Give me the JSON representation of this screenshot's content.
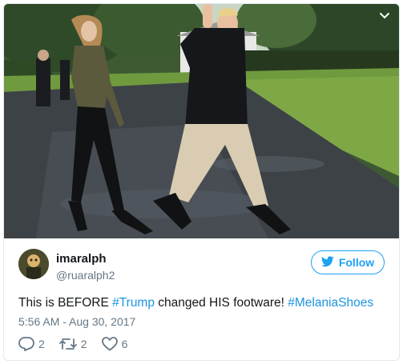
{
  "tweet": {
    "display_name": "imaralph",
    "handle": "@ruaralph2",
    "follow_label": "Follow",
    "text_parts": {
      "p1": "This is BEFORE ",
      "hashtag1": "#Trump",
      "p2": " changed HIS footware! ",
      "hashtag2": "#MelaniaShoes"
    },
    "timestamp": "5:56 AM - Aug 30, 2017",
    "actions": {
      "reply_count": "2",
      "retweet_count": "2",
      "like_count": "6"
    }
  },
  "icons": {
    "follow": "twitter-bird-icon",
    "reply": "reply-icon",
    "retweet": "retweet-icon",
    "like": "heart-icon",
    "menu": "chevron-down-icon"
  },
  "colors": {
    "accent": "#1da1f2",
    "hashtag": "#1b95e0",
    "text": "#14171a",
    "muted": "#657786",
    "border": "#e1e8ed"
  }
}
